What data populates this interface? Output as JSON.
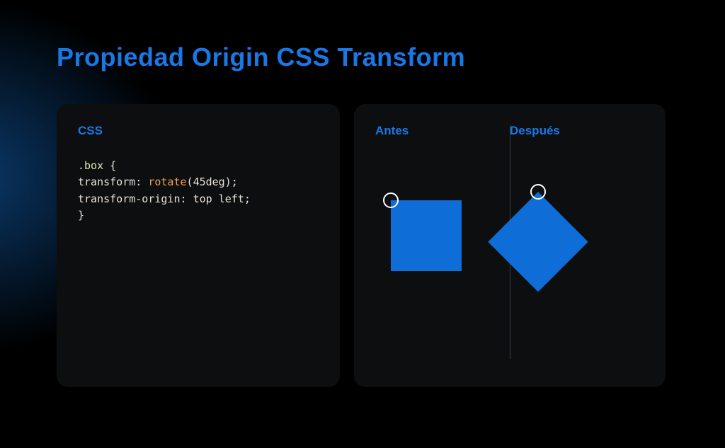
{
  "title": "Propiedad Origin CSS Transform",
  "code_panel": {
    "label": "CSS",
    "selector": ".box",
    "open_brace": "{",
    "prop1": "transform",
    "func": "rotate",
    "arg": "45deg",
    "prop2": "transform-origin",
    "val2": "top left",
    "close_brace": "}",
    "colon": ":",
    "semi": ";",
    "open_paren": "(",
    "close_paren": ")",
    "space": " "
  },
  "visual_panel": {
    "before_label": "Antes",
    "after_label": "Después"
  },
  "colors": {
    "accent": "#1978e5",
    "panel_bg": "#0d0e10",
    "square": "#0f6dd8"
  }
}
